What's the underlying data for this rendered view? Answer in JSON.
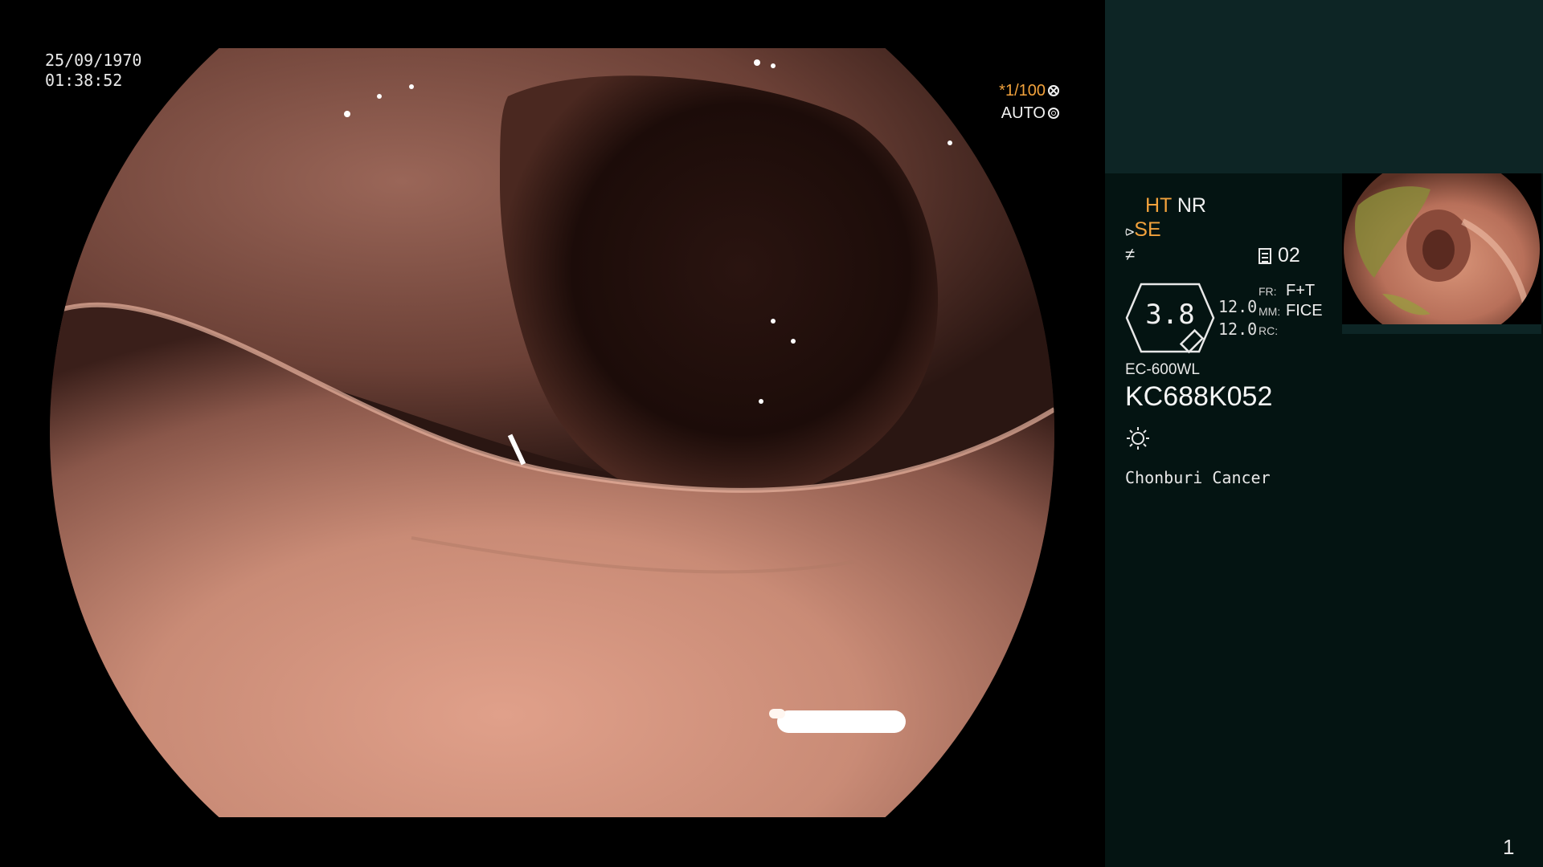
{
  "overlay": {
    "date": "25/09/1970",
    "time": "01:38:52",
    "shutter": "*1/100",
    "shutter_icon": "aperture-icon",
    "iris_mode": "AUTO",
    "iris_icon": "iris-icon"
  },
  "panel": {
    "mode_ht": "HT",
    "mode_nr": "NR",
    "mode_se": "SE",
    "se_icon": "se-icon",
    "fn_icon": "function-icon",
    "memo_icon": "memo-icon",
    "memo_value": "02",
    "hex_value": "3.8",
    "side_value_1": "12.0",
    "side_value_2": "12.0",
    "settings": [
      {
        "key": "FR:",
        "value": "F+T"
      },
      {
        "key": "MM:",
        "value": "FICE"
      },
      {
        "key": "RC:",
        "value": ""
      }
    ],
    "scope_model": "EC-600WL",
    "scope_serial": "KC688K052",
    "light_icon": "light-icon",
    "hospital": "Chonburi Cancer",
    "page_number": "1"
  },
  "colors": {
    "accent_orange": "#f2a23c",
    "panel_bg": "#041412",
    "panel_top_bg": "#0d2525"
  }
}
